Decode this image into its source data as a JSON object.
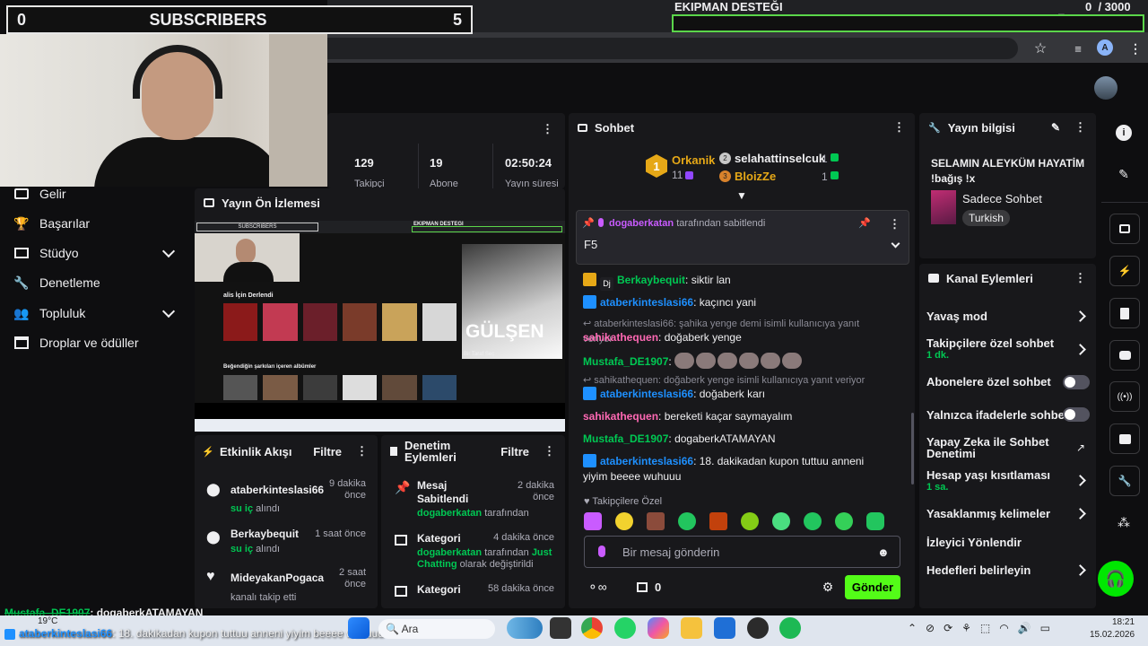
{
  "overlay": {
    "sub_left": "0",
    "sub_title": "SUBSCRIBERS",
    "sub_right": "5",
    "goal_title": "EKIPMAN DESTEĞI",
    "goal_count": "0  / 3000",
    "goal_progress": 0
  },
  "browser": {
    "avatar": "A"
  },
  "stats": {
    "v1": "129",
    "l1": "Takipçi",
    "v2": "19",
    "l2": "Abone",
    "v3": "02:50:24",
    "l3": "Yayın süresi"
  },
  "sidebar": {
    "items": [
      {
        "label": "Gelir"
      },
      {
        "label": "Başarılar"
      },
      {
        "label": "Stüdyo"
      },
      {
        "label": "Denetleme"
      },
      {
        "label": "Topluluk"
      },
      {
        "label": "Droplar ve ödüller"
      }
    ]
  },
  "preview": {
    "title": "Yayın Ön İzlemesi",
    "inner_sub": "SUBSCRIBERS",
    "inner_goal": "EKIPMAN DESTEĞI",
    "album_title": "GÜLŞEN",
    "album_sub": "Bir Taraf Seç",
    "left_heading": "alis İçin Derlendi",
    "left_heading2": "Beğendiğin şarkıları içeren albümler"
  },
  "activity": {
    "title": "Etkinlik Akışı",
    "filter": "Filtre",
    "items": [
      {
        "user": "ataberkinteslasi66",
        "time": "9 dakika önce",
        "action": "su iç",
        "suffix": "alındı"
      },
      {
        "user": "Berkaybequit",
        "time": "1 saat önce",
        "action": "su iç",
        "suffix": "alındı"
      },
      {
        "user": "MideyakanPogaca",
        "time": "2 saat önce",
        "action": "",
        "suffix": "kanalı takip etti"
      }
    ]
  },
  "modlog": {
    "title": "Denetim Eylemleri",
    "filter": "Filtre",
    "items": [
      {
        "type": "Mesaj Sabitlendi",
        "time": "2 dakika önce",
        "user": "dogaberkatan",
        "rest": "tarafından"
      },
      {
        "type": "Kategori",
        "time": "4 dakika önce",
        "user": "dogaberkatan",
        "mid": "tarafından",
        "game": "Just Chatting",
        "rest": "olarak değiştirildi"
      },
      {
        "type": "Kategori",
        "time": "58 dakika önce",
        "user": "",
        "rest": ""
      }
    ]
  },
  "chat": {
    "title": "Sohbet",
    "leader": {
      "rank": "1",
      "name": "Orkanik",
      "points": "11"
    },
    "others": [
      {
        "name": "selahattinselcuk",
        "val": "1"
      },
      {
        "name": "BloizZe",
        "val": "1"
      }
    ],
    "pinned": {
      "by": "dogaberkatan",
      "label": "tarafından sabitlendi",
      "text": "F5"
    },
    "messages": [
      {
        "user": "Berkaybequit",
        "color": "#00c853",
        "text": "siktir lan"
      },
      {
        "user": "ataberkinteslasi66",
        "color": "#1e90ff",
        "text": "kaçıncı yani"
      },
      {
        "reply": "ataberkinteslasi66: şahika yenge demi isimli kullanıcıya yanıt veriyor"
      },
      {
        "user": "sahikathequen",
        "color": "#ff69b4",
        "text": "doğaberk yenge"
      },
      {
        "user": "Mustafa_DE1907",
        "color": "#00c853",
        "text": ""
      },
      {
        "reply": "sahikathequen: doğaberk yenge isimli kullanıcıya yanıt veriyor"
      },
      {
        "user": "ataberkinteslasi66",
        "color": "#1e90ff",
        "text": "doğaberk karı"
      },
      {
        "user": "sahikathequen",
        "color": "#ff69b4",
        "text": "bereketi kaçar saymayalım"
      },
      {
        "user": "Mustafa_DE1907",
        "color": "#00c853",
        "text": "dogaberkATAMAYAN"
      },
      {
        "user": "ataberkinteslasi66",
        "color": "#1e90ff",
        "text": "18. dakikadan kupon tuttuu anneni yiyim beeee wuhuuu"
      }
    ],
    "followers_only": "Takipçilere Özel",
    "placeholder": "Bir mesaj gönderin",
    "points": "0",
    "send": "Gönder"
  },
  "streaminfo": {
    "title": "Yayın bilgisi",
    "stream_title": "SELAMIN ALEYKÜM HAYATİM !bağış !x",
    "category": "Sadece Sohbet",
    "tag": "Turkish"
  },
  "channel": {
    "title": "Kanal Eylemleri",
    "items": [
      {
        "label": "Yavaş mod"
      },
      {
        "label": "Takipçilere özel sohbet",
        "sub": "1 dk."
      },
      {
        "label": "Abonelere özel sohbet"
      },
      {
        "label": "Yalnızca ifadelerle sohbet"
      },
      {
        "label": "Yapay Zeka ile Sohbet Denetimi"
      },
      {
        "label": "Hesap yaşı kısıtlaması",
        "sub": "1 sa."
      },
      {
        "label": "Yasaklanmış kelimeler"
      },
      {
        "label": "İzleyici Yönlendir"
      },
      {
        "label": "Hedefleri belirleyin"
      }
    ]
  },
  "ticker": {
    "line1_user": "Mustafa_DE1907",
    "line1_text": ": dogaberkATAMAYAN",
    "line2_user": "ataberkinteslasi66",
    "line2_text": ": 18. dakikadan kupon tuttuu anneni yiyim beeee wuhuuu"
  },
  "taskbar": {
    "temp": "19°C",
    "search": "Ara",
    "time": "18:21",
    "date": "15.02.2026"
  },
  "colors": {
    "accent": "#00e701",
    "panel": "#18181b",
    "bg": "#0e0e10"
  }
}
